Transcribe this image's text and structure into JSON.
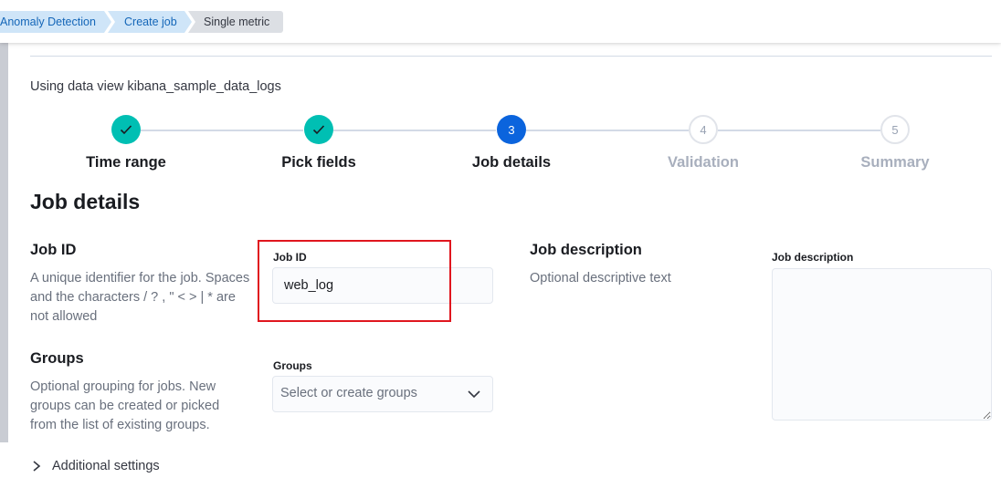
{
  "breadcrumbs": [
    {
      "label": "Anomaly Detection"
    },
    {
      "label": "Create job"
    },
    {
      "label": "Single metric"
    }
  ],
  "data_view_text": "Using data view kibana_sample_data_logs",
  "steps": [
    {
      "number": "1",
      "label": "Time range",
      "status": "complete"
    },
    {
      "number": "2",
      "label": "Pick fields",
      "status": "complete"
    },
    {
      "number": "3",
      "label": "Job details",
      "status": "current"
    },
    {
      "number": "4",
      "label": "Validation",
      "status": "incomplete"
    },
    {
      "number": "5",
      "label": "Summary",
      "status": "incomplete"
    }
  ],
  "page_title": "Job details",
  "job_id": {
    "title": "Job ID",
    "description": "A unique identifier for the job. Spaces and the characters / ? , \" < > | * are not allowed",
    "field_label": "Job ID",
    "value": "web_log"
  },
  "groups": {
    "title": "Groups",
    "description": "Optional grouping for jobs. New groups can be created or picked from the list of existing groups.",
    "field_label": "Groups",
    "placeholder": "Select or create groups"
  },
  "job_description": {
    "title": "Job description",
    "description": "Optional descriptive text",
    "field_label": "Job description",
    "value": ""
  },
  "additional_settings_label": "Additional settings",
  "colors": {
    "complete_step": "#00bfb3",
    "current_step": "#0b64dd",
    "highlight_box": "#e0161e",
    "breadcrumb_link": "#1466b8"
  }
}
